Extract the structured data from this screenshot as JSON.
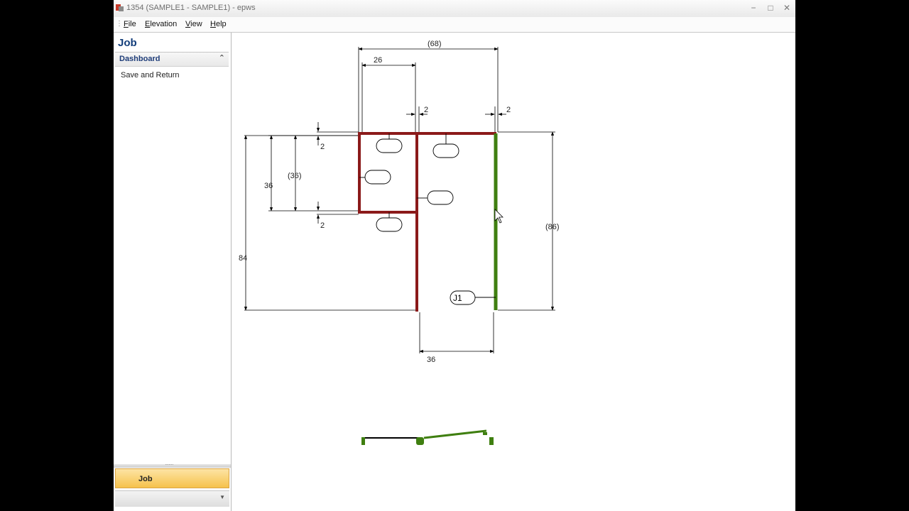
{
  "window": {
    "title": "1354 (SAMPLE1 - SAMPLE1) - epws",
    "minimize_glyph": "−",
    "maximize_glyph": "□",
    "close_glyph": "✕"
  },
  "menubar": {
    "items": [
      {
        "label": "File",
        "mnemonic": "F"
      },
      {
        "label": "Elevation",
        "mnemonic": "E"
      },
      {
        "label": "View",
        "mnemonic": "V"
      },
      {
        "label": "Help",
        "mnemonic": "H"
      }
    ]
  },
  "sidebar": {
    "title": "Job",
    "section": "Dashboard",
    "links": [
      "Save and Return"
    ],
    "bottom_button": "Job"
  },
  "drawing": {
    "frame_color": "#8b1a1a",
    "jamb_color": "#3f7f10",
    "dimensions": {
      "top_overall": "(68)",
      "top_left": "26",
      "gap_a": "2",
      "gap_b": "2",
      "left_gap_top": "2",
      "left_inner": "36",
      "left_paren": "(36)",
      "left_gap_bottom": "2",
      "left_overall": "84",
      "right_overall": "(86)",
      "bottom": "36"
    },
    "tag_label": "J1"
  }
}
